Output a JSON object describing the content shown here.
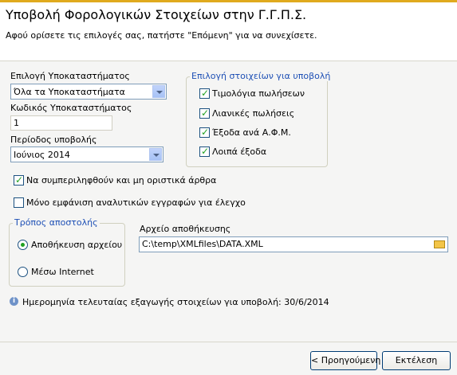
{
  "header": {
    "title": "Υποβολή Φορολογικών Στοιχείων στην Γ.Γ.Π.Σ.",
    "subtitle": "Αφού ορίσετε τις επιλογές σας, πατήστε \"Επόμενη\" για να συνεχίσετε."
  },
  "branch": {
    "label": "Επιλογή Υποκαταστήματος",
    "value": "Όλα τα Υποκαταστήματα"
  },
  "branch_code": {
    "label": "Κωδικός Υποκαταστήματος",
    "value": "1"
  },
  "period": {
    "label": "Περίοδος υποβολής",
    "value": "Ιούνιος 2014"
  },
  "items_group": {
    "title": "Επιλογή στοιχείων για υποβολή",
    "items": [
      {
        "label": "Τιμολόγια πωλήσεων",
        "checked": true
      },
      {
        "label": "Λιανικές πωλήσεις",
        "checked": true
      },
      {
        "label": "Έξοδα ανά Α.Φ.Μ.",
        "checked": true
      },
      {
        "label": "Λοιπά έξοδα",
        "checked": true
      }
    ]
  },
  "options": {
    "include_unfinalized": {
      "label": "Να συμπεριληφθούν και μη οριστικά άρθρα",
      "checked": true
    },
    "show_analytic_only": {
      "label": "Μόνο εμφάνιση αναλυτικών εγγραφών για έλεγχο",
      "checked": false
    }
  },
  "send_method": {
    "title": "Τρόπος αποστολής",
    "options": [
      {
        "label": "Αποθήκευση αρχείου",
        "selected": true
      },
      {
        "label": "Μέσω Internet",
        "selected": false
      }
    ]
  },
  "save_file": {
    "label": "Αρχείο αποθήκευσης",
    "value": "C:\\temp\\XMLfiles\\DATA.XML"
  },
  "info": {
    "text": "Ημερομηνία τελευταίας εξαγωγής στοιχείων για υποβολή: 30/6/2014"
  },
  "buttons": {
    "previous": "< Προηγούμενη",
    "execute": "Εκτέλεση"
  }
}
